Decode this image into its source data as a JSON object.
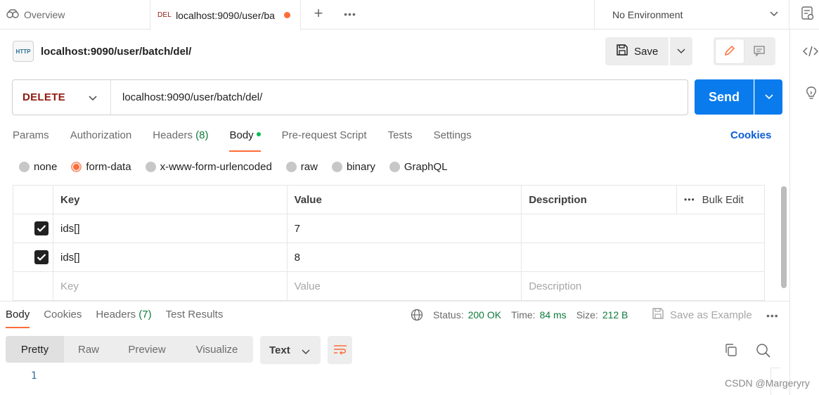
{
  "tabs": {
    "overview_label": "Overview",
    "active_method": "DEL",
    "active_url": "localhost:9090/user/ba",
    "plus": "+",
    "more": "•••"
  },
  "environment": {
    "label": "No Environment"
  },
  "request": {
    "title": "localhost:9090/user/batch/del/",
    "http_badge": "HTTP",
    "save_label": "Save",
    "method": "DELETE",
    "url": "localhost:9090/user/batch/del/",
    "send_label": "Send"
  },
  "request_tabs": {
    "params": "Params",
    "authorization": "Authorization",
    "headers": "Headers",
    "headers_count": "(8)",
    "body": "Body",
    "prerequest": "Pre-request Script",
    "tests": "Tests",
    "settings": "Settings",
    "cookies": "Cookies"
  },
  "body_types": {
    "none": "none",
    "form_data": "form-data",
    "urlencoded": "x-www-form-urlencoded",
    "raw": "raw",
    "binary": "binary",
    "graphql": "GraphQL"
  },
  "table": {
    "headers": {
      "key": "Key",
      "value": "Value",
      "description": "Description",
      "bulk_edit": "Bulk Edit",
      "more": "•••"
    },
    "rows": [
      {
        "key": "ids[]",
        "value": "7",
        "description": ""
      },
      {
        "key": "ids[]",
        "value": "8",
        "description": ""
      }
    ],
    "placeholder": {
      "key": "Key",
      "value": "Value",
      "description": "Description"
    }
  },
  "response": {
    "tabs": {
      "body": "Body",
      "cookies": "Cookies",
      "headers": "Headers",
      "headers_count": "(7)",
      "test_results": "Test Results"
    },
    "status_label": "Status:",
    "status_value": "200 OK",
    "time_label": "Time:",
    "time_value": "84 ms",
    "size_label": "Size:",
    "size_value": "212 B",
    "save_example": "Save as Example",
    "more": "•••",
    "views": {
      "pretty": "Pretty",
      "raw": "Raw",
      "preview": "Preview",
      "visualize": "Visualize"
    },
    "format": "Text",
    "line_number": "1"
  },
  "watermark": "CSDN @Margeryry",
  "colors": {
    "accent": "#ff6c37",
    "send": "#097bed",
    "method_delete": "#8e1a10",
    "success": "#0f7b3d",
    "link": "#0b5cd5"
  }
}
